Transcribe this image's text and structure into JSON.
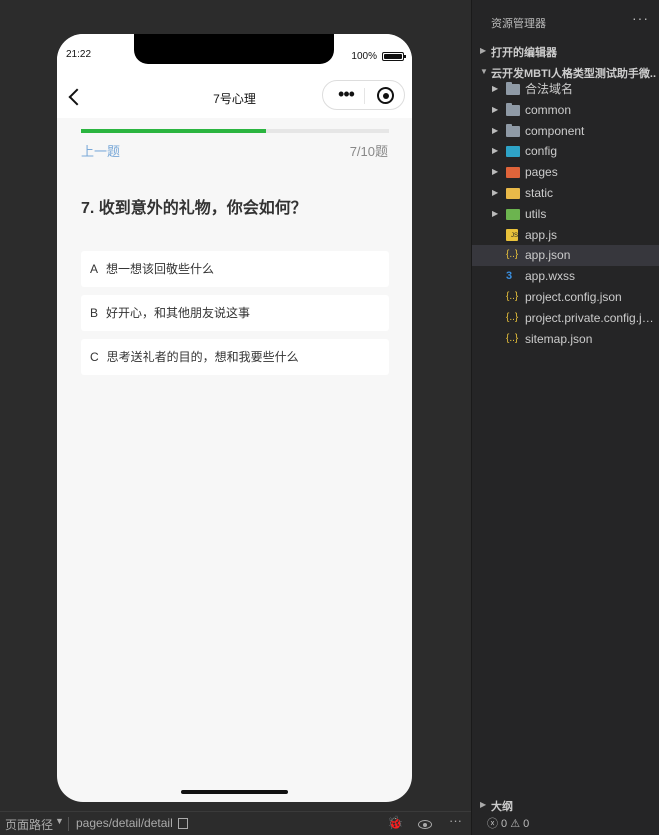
{
  "simulator": {
    "status_time": "21:22",
    "battery_text": "100%",
    "nav_title": "7号心理",
    "capsule_dots": "•••",
    "progress": 0.6,
    "prev_label": "上一题",
    "count_label": "7/10题",
    "question": "7. 收到意外的礼物，你会如何？",
    "options": [
      {
        "key": "A",
        "text": "想一想该回敬些什么"
      },
      {
        "key": "B",
        "text": "好开心，和其他朋友说这事"
      },
      {
        "key": "C",
        "text": "思考送礼者的目的，想和我要些什么"
      }
    ]
  },
  "bottombar": {
    "label": "页面路径",
    "caret": "▼",
    "path": "pages/detail/detail",
    "bug_icon": "🐞",
    "more": "···"
  },
  "explorer": {
    "title": "资源管理器",
    "more": "···",
    "open_editors": "打开的编辑器",
    "project": "云开发MBTI人格类型测试助手微...",
    "items": [
      {
        "label": "合法域名",
        "type": "folder",
        "arrow": "▶"
      },
      {
        "label": "common",
        "type": "folder",
        "arrow": "▶"
      },
      {
        "label": "component",
        "type": "folder",
        "arrow": "▶"
      },
      {
        "label": "config",
        "type": "cfg",
        "arrow": "▶"
      },
      {
        "label": "pages",
        "type": "pages",
        "arrow": "▶"
      },
      {
        "label": "static",
        "type": "static",
        "arrow": "▶"
      },
      {
        "label": "utils",
        "type": "utils",
        "arrow": "▶"
      },
      {
        "label": "app.js",
        "type": "js",
        "glyph": "JS"
      },
      {
        "label": "app.json",
        "type": "json",
        "glyph": "{..}",
        "active": true
      },
      {
        "label": "app.wxss",
        "type": "wxss",
        "glyph": "3"
      },
      {
        "label": "project.config.json",
        "type": "json",
        "glyph": "{..}"
      },
      {
        "label": "project.private.config.js...",
        "type": "json",
        "glyph": "{..}"
      },
      {
        "label": "sitemap.json",
        "type": "json",
        "glyph": "{..}"
      }
    ],
    "outline": "大纲",
    "errors": "ⓧ 0 ⚠ 0"
  },
  "colors": {
    "progress_fill": "#2bb540",
    "prev_link": "#79a8d8",
    "ide_bg": "#2c2c2c",
    "panel_bg": "#252526",
    "active_row": "#37373d"
  }
}
